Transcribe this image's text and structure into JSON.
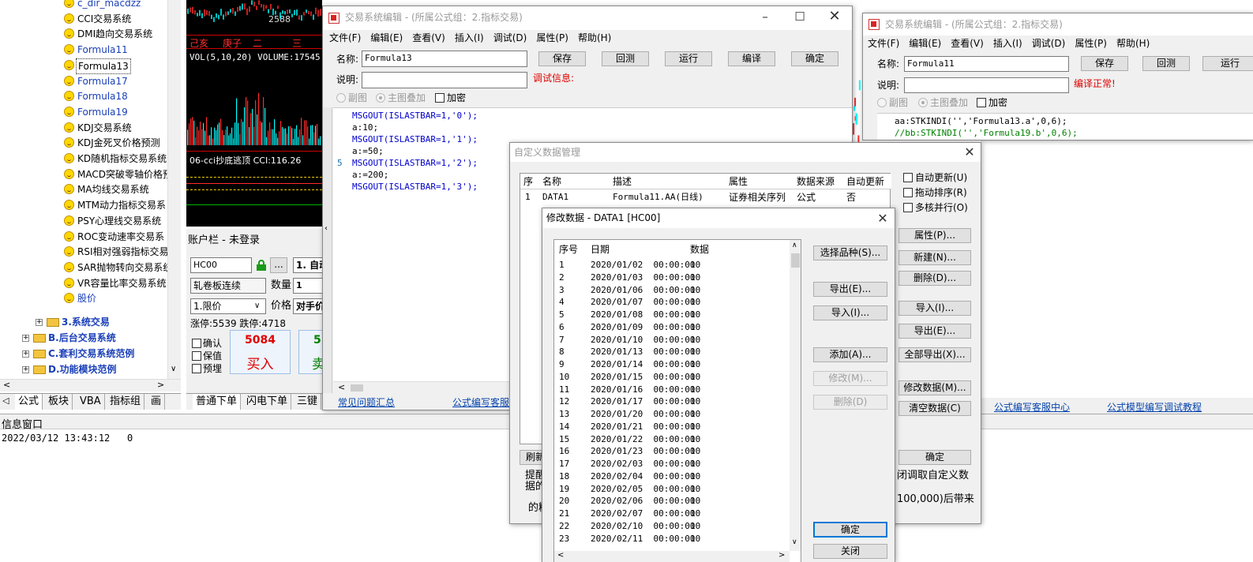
{
  "tree": {
    "items": [
      {
        "label": "c_dir_macdzz",
        "blue": true
      },
      {
        "label": "CCI交易系统",
        "blue": false
      },
      {
        "label": "DMI趋向交易系统",
        "blue": false
      },
      {
        "label": "Formula11",
        "blue": true
      },
      {
        "label": "Formula13",
        "blue": false,
        "selected": true
      },
      {
        "label": "Formula17",
        "blue": true
      },
      {
        "label": "Formula18",
        "blue": true
      },
      {
        "label": "Formula19",
        "blue": true
      },
      {
        "label": "KDJ交易系统",
        "blue": false
      },
      {
        "label": "KDJ金死叉价格预测",
        "blue": false
      },
      {
        "label": "KD随机指标交易系统",
        "blue": false
      },
      {
        "label": "MACD突破零轴价格预",
        "blue": false
      },
      {
        "label": "MA均线交易系统",
        "blue": false
      },
      {
        "label": "MTM动力指标交易系",
        "blue": false
      },
      {
        "label": "PSY心理线交易系统",
        "blue": false
      },
      {
        "label": "ROC变动速率交易系",
        "blue": false
      },
      {
        "label": "RSI相对强弱指标交易",
        "blue": false
      },
      {
        "label": "SAR抛物转向交易系统",
        "blue": false
      },
      {
        "label": "VR容量比率交易系统",
        "blue": false
      },
      {
        "label": "股价",
        "blue": true
      }
    ],
    "groups": [
      "3.系统交易",
      "B.后台交易系统",
      "C.套利交易系统范例",
      "D.功能模块范例"
    ]
  },
  "bottom_tabs": [
    "公式",
    "板块",
    "VBA",
    "指标组",
    "画"
  ],
  "chart": {
    "top_number": "2588",
    "date_cells": [
      "己亥",
      "庚子",
      "二",
      "三"
    ],
    "vol_label": "VOL(5,10,20) VOLUME:17545",
    "cci_label": "06-cci抄底逃顶 CCI:116.26",
    "colors": {
      "up": "#ff2a2a",
      "down": "#00ffff",
      "bg": "#000000"
    }
  },
  "account": {
    "title": "账户栏 - 未登录",
    "code": "HC00",
    "ellipsis": "...",
    "auto_label": "1. 自动",
    "strategy": "轧卷板连续",
    "qty_label": "数量",
    "qty": "1",
    "price_type": "1.限价",
    "price_label": "价格",
    "price_value": "对手价",
    "limit_info": "涨停:5539 跌停:4718",
    "checks": [
      "确认",
      "保值",
      "预埋"
    ],
    "buy_price": "5084",
    "buy_label": "买入",
    "sell_price": "5",
    "sell_label": "卖",
    "tabs": [
      "普通下单",
      "闪电下单",
      "三键"
    ]
  },
  "info": {
    "title": "信息窗口",
    "log": "2022/03/12 13:43:12   0"
  },
  "editor1": {
    "title": "交易系统编辑 - (所属公式组：2.指标交易)",
    "menu": [
      "文件(F)",
      "编辑(E)",
      "查看(V)",
      "插入(I)",
      "调试(D)",
      "属性(P)",
      "帮助(H)"
    ],
    "name_label": "名称:",
    "name_value": "Formula13",
    "desc_label": "说明:",
    "debug_label": "调试信息:",
    "buttons": [
      "保存",
      "回测",
      "运行",
      "编译",
      "确定"
    ],
    "radios": [
      "副图",
      "主图叠加"
    ],
    "encrypt": "加密",
    "code": [
      "MSGOUT(ISLASTBAR=1,'0');",
      "a:10;",
      "MSGOUT(ISLASTBAR=1,'1');",
      "a:=50;",
      "MSGOUT(ISLASTBAR=1,'2');",
      "a:=200;",
      "MSGOUT(ISLASTBAR=1,'3');"
    ],
    "line_marker": "5",
    "links": [
      "常见问题汇总",
      "公式编写客服"
    ]
  },
  "editor2": {
    "title": "交易系统编辑 - (所属公式组：2.指标交易)",
    "menu": [
      "文件(F)",
      "编辑(E)",
      "查看(V)",
      "插入(I)",
      "调试(D)",
      "属性(P)",
      "帮助(H)"
    ],
    "name_label": "名称:",
    "name_value": "Formula11",
    "desc_label": "说明:",
    "status": "编译正常!",
    "buttons": [
      "保存",
      "回测",
      "运行"
    ],
    "radios": [
      "副图",
      "主图叠加"
    ],
    "encrypt": "加密",
    "code": [
      "aa:STKINDI('','Formula13.a',0,6);",
      "//bb:STKINDI('','Formula19.b',0,6);"
    ],
    "links": [
      "公式编写客服中心",
      "公式模型编写调试教程"
    ]
  },
  "custom": {
    "title": "自定义数据管理",
    "headers": [
      "序",
      "名称",
      "描述",
      "属性",
      "数据来源",
      "自动更新"
    ],
    "row": [
      "1",
      "DATA1",
      "Formula11.AA(日线)",
      "证券相关序列",
      "公式",
      "否"
    ],
    "checks": [
      "自动更新(U)",
      "拖动排序(R)",
      "多核并行(O)"
    ],
    "buttons": [
      "属性(P)...",
      "新建(N)...",
      "删除(D)...",
      "导入(I)...",
      "导出(E)...",
      "全部导出(X)...",
      "修改数据(M)...",
      "清空数据(C)",
      "确定"
    ],
    "refresh": "刷新",
    "note1": "提醒",
    "note2": "据的",
    "note3": "的精",
    "note_right1": "闭调取自定义数",
    "note_right2": "100,000)后带来"
  },
  "modify": {
    "title": "修改数据 - DATA1 [HC00]",
    "headers": [
      "序号",
      "日期",
      "数据"
    ],
    "rows": [
      [
        "1",
        "2020/01/02  00:00:00",
        "10"
      ],
      [
        "2",
        "2020/01/03  00:00:00",
        "10"
      ],
      [
        "3",
        "2020/01/06  00:00:00",
        "10"
      ],
      [
        "4",
        "2020/01/07  00:00:00",
        "10"
      ],
      [
        "5",
        "2020/01/08  00:00:00",
        "10"
      ],
      [
        "6",
        "2020/01/09  00:00:00",
        "10"
      ],
      [
        "7",
        "2020/01/10  00:00:00",
        "10"
      ],
      [
        "8",
        "2020/01/13  00:00:00",
        "10"
      ],
      [
        "9",
        "2020/01/14  00:00:00",
        "10"
      ],
      [
        "10",
        "2020/01/15  00:00:00",
        "10"
      ],
      [
        "11",
        "2020/01/16  00:00:00",
        "10"
      ],
      [
        "12",
        "2020/01/17  00:00:00",
        "10"
      ],
      [
        "13",
        "2020/01/20  00:00:00",
        "10"
      ],
      [
        "14",
        "2020/01/21  00:00:00",
        "10"
      ],
      [
        "15",
        "2020/01/22  00:00:00",
        "10"
      ],
      [
        "16",
        "2020/01/23  00:00:00",
        "10"
      ],
      [
        "17",
        "2020/02/03  00:00:00",
        "10"
      ],
      [
        "18",
        "2020/02/04  00:00:00",
        "10"
      ],
      [
        "19",
        "2020/02/05  00:00:00",
        "10"
      ],
      [
        "20",
        "2020/02/06  00:00:00",
        "10"
      ],
      [
        "21",
        "2020/02/07  00:00:00",
        "10"
      ],
      [
        "22",
        "2020/02/10  00:00:00",
        "10"
      ],
      [
        "23",
        "2020/02/11  00:00:00",
        "10"
      ]
    ],
    "buttons": [
      "选择品种(S)...",
      "导出(E)...",
      "导入(I)...",
      "添加(A)...",
      "修改(M)...",
      "删除(D)",
      "确定",
      "关闭"
    ]
  }
}
